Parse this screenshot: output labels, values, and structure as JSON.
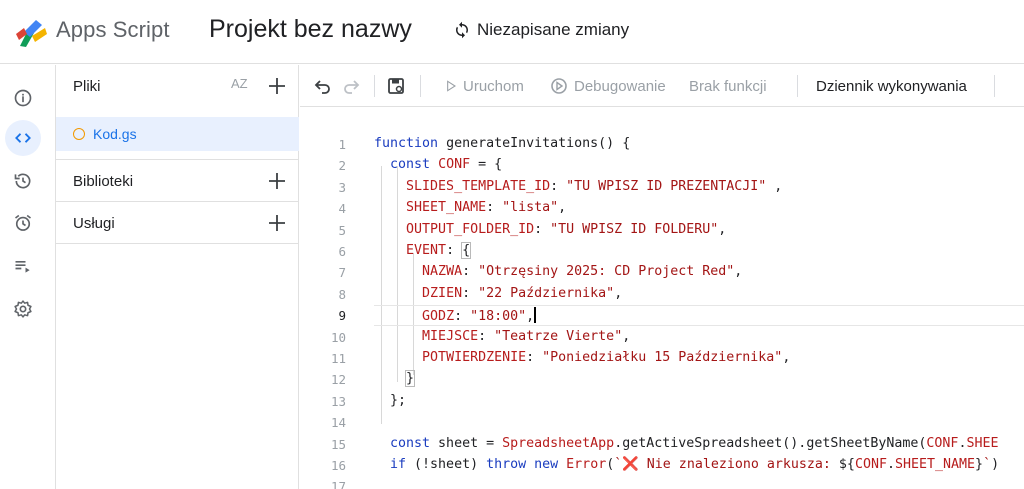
{
  "header": {
    "brand": "Apps Script",
    "project_title": "Projekt bez nazwy",
    "status": "Niezapisane zmiany"
  },
  "rail": {
    "items": [
      {
        "name": "overview",
        "icon": "info-icon"
      },
      {
        "name": "editor",
        "icon": "code-icon",
        "active": true
      },
      {
        "name": "executions",
        "icon": "history-icon"
      },
      {
        "name": "triggers",
        "icon": "alarm-icon"
      },
      {
        "name": "executions-list",
        "icon": "playlist-icon"
      },
      {
        "name": "settings",
        "icon": "gear-icon"
      }
    ]
  },
  "files_panel": {
    "title": "Pliki",
    "sort_label": "AZ",
    "files": [
      {
        "name": "Kod.gs",
        "active": true
      }
    ],
    "sections": {
      "libraries": "Biblioteki",
      "services": "Usługi"
    }
  },
  "toolbar": {
    "run": "Uruchom",
    "debug": "Debugowanie",
    "function_select": "Brak funkcji",
    "execution_log": "Dziennik wykonywania"
  },
  "editor": {
    "current_line": 9,
    "lines": [
      {
        "n": "1",
        "code": "function generateInvitations() {"
      },
      {
        "n": "2",
        "code": "  const CONF = {"
      },
      {
        "n": "3",
        "code": "    SLIDES_TEMPLATE_ID: \"TU WPISZ ID PREZENTACJI\" ,"
      },
      {
        "n": "4",
        "code": "    SHEET_NAME: \"lista\","
      },
      {
        "n": "5",
        "code": "    OUTPUT_FOLDER_ID: \"TU WPISZ ID FOLDERU\","
      },
      {
        "n": "6",
        "code": "    EVENT: {"
      },
      {
        "n": "7",
        "code": "      NAZWA: \"Otrzęsiny 2025: CD Project Red\","
      },
      {
        "n": "8",
        "code": "      DZIEN: \"22 Października\","
      },
      {
        "n": "9",
        "code": "      GODZ: \"18:00\","
      },
      {
        "n": "10",
        "code": "      MIEJSCE: \"Teatrze Vierte\","
      },
      {
        "n": "11",
        "code": "      POTWIERDZENIE: \"Poniedziałku 15 Października\","
      },
      {
        "n": "12",
        "code": "    }"
      },
      {
        "n": "13",
        "code": "  };"
      },
      {
        "n": "14",
        "code": ""
      },
      {
        "n": "15",
        "code": "  const sheet = SpreadsheetApp.getActiveSpreadsheet().getSheetByName(CONF.SHEE"
      },
      {
        "n": "16",
        "code": "  if (!sheet) throw new Error(`❌ Nie znaleziono arkusza: ${CONF.SHEET_NAME}`)"
      },
      {
        "n": "17",
        "code": ""
      }
    ]
  },
  "colors": {
    "accent": "#1a73e8",
    "active_bg": "#e8f0fe",
    "keyword": "#1a3cbf",
    "string": "#a31515",
    "property": "#b71c1c"
  }
}
